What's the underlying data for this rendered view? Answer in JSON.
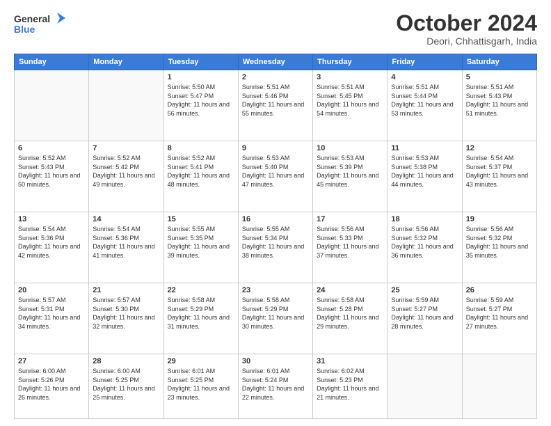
{
  "logo": {
    "line1": "General",
    "line2": "Blue"
  },
  "header": {
    "month": "October 2024",
    "location": "Deori, Chhattisgarh, India"
  },
  "weekdays": [
    "Sunday",
    "Monday",
    "Tuesday",
    "Wednesday",
    "Thursday",
    "Friday",
    "Saturday"
  ],
  "rows": [
    [
      {
        "day": "",
        "empty": true
      },
      {
        "day": "",
        "empty": true
      },
      {
        "day": "1",
        "sunrise": "5:50 AM",
        "sunset": "5:47 PM",
        "daylight": "11 hours and 56 minutes."
      },
      {
        "day": "2",
        "sunrise": "5:51 AM",
        "sunset": "5:46 PM",
        "daylight": "11 hours and 55 minutes."
      },
      {
        "day": "3",
        "sunrise": "5:51 AM",
        "sunset": "5:45 PM",
        "daylight": "11 hours and 54 minutes."
      },
      {
        "day": "4",
        "sunrise": "5:51 AM",
        "sunset": "5:44 PM",
        "daylight": "11 hours and 53 minutes."
      },
      {
        "day": "5",
        "sunrise": "5:51 AM",
        "sunset": "5:43 PM",
        "daylight": "11 hours and 51 minutes."
      }
    ],
    [
      {
        "day": "6",
        "sunrise": "5:52 AM",
        "sunset": "5:43 PM",
        "daylight": "11 hours and 50 minutes."
      },
      {
        "day": "7",
        "sunrise": "5:52 AM",
        "sunset": "5:42 PM",
        "daylight": "11 hours and 49 minutes."
      },
      {
        "day": "8",
        "sunrise": "5:52 AM",
        "sunset": "5:41 PM",
        "daylight": "11 hours and 48 minutes."
      },
      {
        "day": "9",
        "sunrise": "5:53 AM",
        "sunset": "5:40 PM",
        "daylight": "11 hours and 47 minutes."
      },
      {
        "day": "10",
        "sunrise": "5:53 AM",
        "sunset": "5:39 PM",
        "daylight": "11 hours and 45 minutes."
      },
      {
        "day": "11",
        "sunrise": "5:53 AM",
        "sunset": "5:38 PM",
        "daylight": "11 hours and 44 minutes."
      },
      {
        "day": "12",
        "sunrise": "5:54 AM",
        "sunset": "5:37 PM",
        "daylight": "11 hours and 43 minutes."
      }
    ],
    [
      {
        "day": "13",
        "sunrise": "5:54 AM",
        "sunset": "5:36 PM",
        "daylight": "11 hours and 42 minutes."
      },
      {
        "day": "14",
        "sunrise": "5:54 AM",
        "sunset": "5:36 PM",
        "daylight": "11 hours and 41 minutes."
      },
      {
        "day": "15",
        "sunrise": "5:55 AM",
        "sunset": "5:35 PM",
        "daylight": "11 hours and 39 minutes."
      },
      {
        "day": "16",
        "sunrise": "5:55 AM",
        "sunset": "5:34 PM",
        "daylight": "11 hours and 38 minutes."
      },
      {
        "day": "17",
        "sunrise": "5:56 AM",
        "sunset": "5:33 PM",
        "daylight": "11 hours and 37 minutes."
      },
      {
        "day": "18",
        "sunrise": "5:56 AM",
        "sunset": "5:32 PM",
        "daylight": "11 hours and 36 minutes."
      },
      {
        "day": "19",
        "sunrise": "5:56 AM",
        "sunset": "5:32 PM",
        "daylight": "11 hours and 35 minutes."
      }
    ],
    [
      {
        "day": "20",
        "sunrise": "5:57 AM",
        "sunset": "5:31 PM",
        "daylight": "11 hours and 34 minutes."
      },
      {
        "day": "21",
        "sunrise": "5:57 AM",
        "sunset": "5:30 PM",
        "daylight": "11 hours and 32 minutes."
      },
      {
        "day": "22",
        "sunrise": "5:58 AM",
        "sunset": "5:29 PM",
        "daylight": "11 hours and 31 minutes."
      },
      {
        "day": "23",
        "sunrise": "5:58 AM",
        "sunset": "5:29 PM",
        "daylight": "11 hours and 30 minutes."
      },
      {
        "day": "24",
        "sunrise": "5:58 AM",
        "sunset": "5:28 PM",
        "daylight": "11 hours and 29 minutes."
      },
      {
        "day": "25",
        "sunrise": "5:59 AM",
        "sunset": "5:27 PM",
        "daylight": "11 hours and 28 minutes."
      },
      {
        "day": "26",
        "sunrise": "5:59 AM",
        "sunset": "5:27 PM",
        "daylight": "11 hours and 27 minutes."
      }
    ],
    [
      {
        "day": "27",
        "sunrise": "6:00 AM",
        "sunset": "5:26 PM",
        "daylight": "11 hours and 26 minutes."
      },
      {
        "day": "28",
        "sunrise": "6:00 AM",
        "sunset": "5:25 PM",
        "daylight": "11 hours and 25 minutes."
      },
      {
        "day": "29",
        "sunrise": "6:01 AM",
        "sunset": "5:25 PM",
        "daylight": "11 hours and 23 minutes."
      },
      {
        "day": "30",
        "sunrise": "6:01 AM",
        "sunset": "5:24 PM",
        "daylight": "11 hours and 22 minutes."
      },
      {
        "day": "31",
        "sunrise": "6:02 AM",
        "sunset": "5:23 PM",
        "daylight": "11 hours and 21 minutes."
      },
      {
        "day": "",
        "empty": true
      },
      {
        "day": "",
        "empty": true
      }
    ]
  ],
  "labels": {
    "sunrise_prefix": "Sunrise: ",
    "sunset_prefix": "Sunset: ",
    "daylight_prefix": "Daylight: "
  }
}
